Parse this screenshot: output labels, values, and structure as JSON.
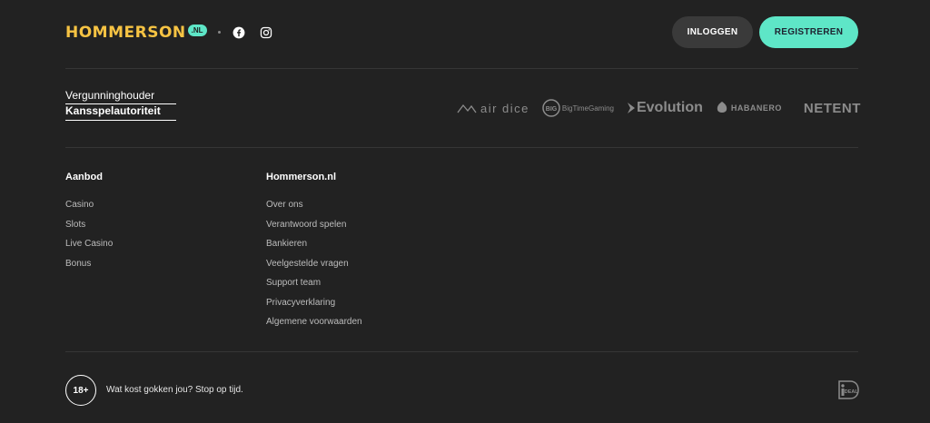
{
  "header": {
    "logo_text": "HOMMERSON",
    "logo_badge": ".NL",
    "social": [
      "facebook-icon",
      "instagram-icon"
    ],
    "login_label": "INLOGGEN",
    "register_label": "REGISTREREN"
  },
  "license": {
    "line1": "Vergunninghouder",
    "line2": "Kansspelautoriteit"
  },
  "providers": {
    "airdice": "air dice",
    "btg": "BigTimeGaming",
    "evolution": "Evolution",
    "habanero": "HABANERO",
    "netent": "NETENT"
  },
  "columns": [
    {
      "title": "Aanbod",
      "links": [
        "Casino",
        "Slots",
        "Live Casino",
        "Bonus"
      ]
    },
    {
      "title": "Hommerson.nl",
      "links": [
        "Over ons",
        "Verantwoord spelen",
        "Bankieren",
        "Veelgestelde vragen",
        "Support team",
        "Privacyverklaring",
        "Algemene voorwaarden"
      ]
    }
  ],
  "footer": {
    "age_badge": "18+",
    "responsible_text": "Wat kost gokken jou? Stop op tijd.",
    "payment_icon": "ideal-icon"
  },
  "colors": {
    "background": "#222222",
    "brand_yellow": "#f6c343",
    "accent_teal": "#5ee6c7"
  }
}
